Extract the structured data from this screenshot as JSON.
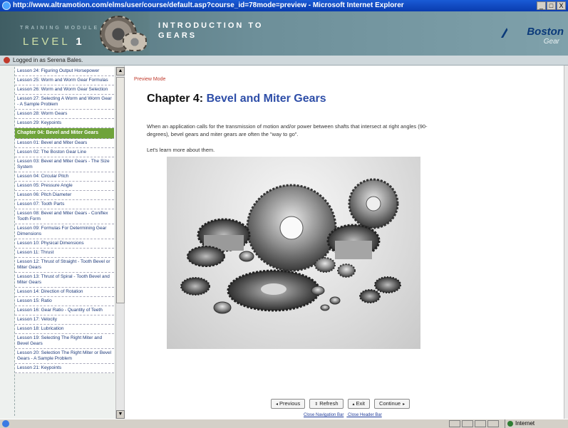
{
  "window": {
    "title": "http://www.altramotion.com/elms/user/course/default.asp?course_id=78mode=preview - Microsoft Internet Explorer",
    "buttons": [
      "_",
      "□",
      "X"
    ]
  },
  "header": {
    "module_label": "TRAINING MODULE",
    "level_label": "LEVEL",
    "level_number": "1",
    "course_title_line1": "INTRODUCTION TO",
    "course_title_line2": "GEARS",
    "logo_brand": "Boston",
    "logo_sub": "Gear"
  },
  "login": {
    "text": "Logged in as Serena Bales."
  },
  "sidebar": {
    "items": [
      {
        "label": "Lesson 24:  Figuring Output Horsepower",
        "type": "lesson"
      },
      {
        "label": "Lesson 25:  Worm and Worm Gear Formulas",
        "type": "lesson"
      },
      {
        "label": "Lesson 26:  Worm and Worm Gear Selection",
        "type": "lesson"
      },
      {
        "label": "Lesson 27:  Selecting A Worm and Worm Gear - A Sample Problem",
        "type": "lesson"
      },
      {
        "label": "Lesson 28:  Worm Gears",
        "type": "lesson"
      },
      {
        "label": "Lesson 29:  Keypoints",
        "type": "lesson"
      },
      {
        "label": "Chapter 04:  Bevel and Miter Gears",
        "type": "chapter"
      },
      {
        "label": "Lesson 01:  Bevel and Miter Gears",
        "type": "lesson"
      },
      {
        "label": "Lesson 02:  The Boston Gear Line",
        "type": "lesson"
      },
      {
        "label": "Lesson 03:  Bevel and Miter Gears - The Size System",
        "type": "lesson"
      },
      {
        "label": "Lesson 04:  Circular Pitch",
        "type": "lesson"
      },
      {
        "label": "Lesson 05:  Pressure Angle",
        "type": "lesson"
      },
      {
        "label": "Lesson 06:  Pitch Diameter",
        "type": "lesson"
      },
      {
        "label": "Lesson 07:  Tooth Parts",
        "type": "lesson"
      },
      {
        "label": "Lesson 08:  Bevel and Miter Gears - Coniflex Tooth Form",
        "type": "lesson"
      },
      {
        "label": "Lesson 09:  Formulas For Determining Gear Dimensions",
        "type": "lesson"
      },
      {
        "label": "Lesson 10:  Physical Dimensions",
        "type": "lesson"
      },
      {
        "label": "Lesson 11:  Thrust",
        "type": "lesson"
      },
      {
        "label": "Lesson 12:  Thrust of Straight - Tooth Bevel or Miter Gears",
        "type": "lesson"
      },
      {
        "label": "Lesson 13:  Thrust of Spiral - Tooth Bevel and Miter Gears",
        "type": "lesson"
      },
      {
        "label": "Lesson 14:  Direction of Rotation",
        "type": "lesson"
      },
      {
        "label": "Lesson 15:  Ratio",
        "type": "lesson"
      },
      {
        "label": "Lesson 16:  Gear Ratio - Quantity of Teeth",
        "type": "lesson"
      },
      {
        "label": "Lesson 17:  Velocity",
        "type": "lesson"
      },
      {
        "label": "Lesson 18:  Lubrication",
        "type": "lesson"
      },
      {
        "label": "Lesson 19:  Selecting The Right Miter and Bevel Gears",
        "type": "lesson"
      },
      {
        "label": "Lesson 20:  Selection The Right Miter or Bevel Gears - A Sample Problem",
        "type": "lesson"
      },
      {
        "label": "Lesson 21:  Keypoints",
        "type": "lesson"
      }
    ]
  },
  "main": {
    "preview_mode": "Preview Mode",
    "chapter_prefix": "Chapter 4:",
    "chapter_name": "Bevel and Miter Gears",
    "intro": "When an application calls for the transmission of motion and/or power between shafts that intersect at right angles (90-degrees), bevel gears and miter gears are often the \"way to go\".",
    "learn_more": "Let's learn more about them.",
    "nav": {
      "previous": "Previous",
      "refresh": "Refresh",
      "exit": "Exit",
      "continue": "Continue"
    },
    "close_nav": "Close Navigation Bar",
    "close_header": "Close Header Bar"
  },
  "status": {
    "zone": "Internet"
  }
}
